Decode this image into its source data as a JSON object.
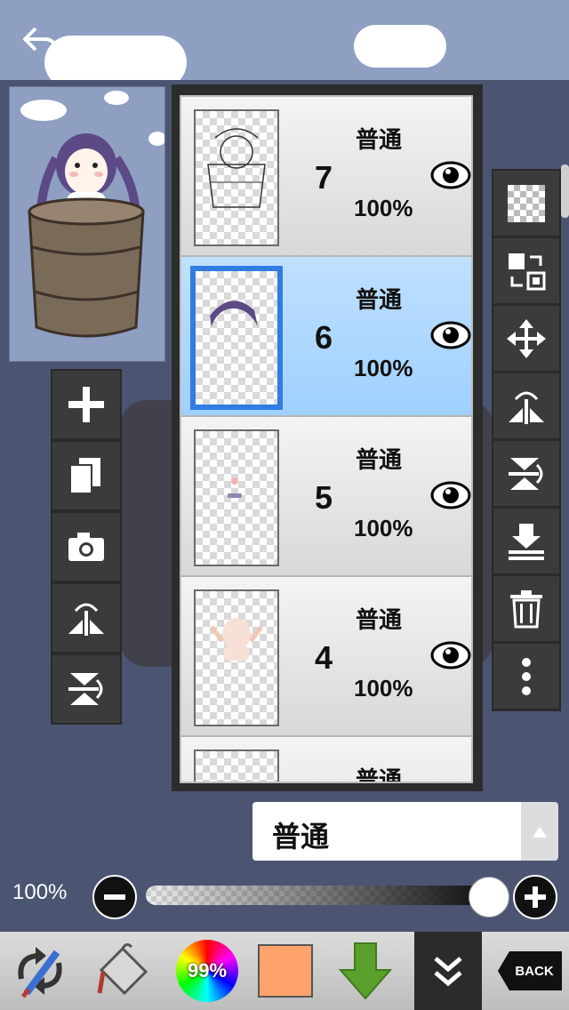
{
  "layers": [
    {
      "number": "7",
      "blend": "普通",
      "opacity": "100%",
      "visible": true,
      "selected": false
    },
    {
      "number": "6",
      "blend": "普通",
      "opacity": "100%",
      "visible": true,
      "selected": true
    },
    {
      "number": "5",
      "blend": "普通",
      "opacity": "100%",
      "visible": true,
      "selected": false
    },
    {
      "number": "4",
      "blend": "普通",
      "opacity": "100%",
      "visible": true,
      "selected": false
    },
    {
      "number": "",
      "blend": "普通",
      "opacity": "",
      "visible": true,
      "selected": false
    }
  ],
  "blend_mode": {
    "selected": "普通"
  },
  "opacity_control": {
    "label": "100%",
    "value": 1.0
  },
  "bottom_bar": {
    "color_wheel_label": "99%",
    "current_color": "#ffa26b",
    "back_label": "BACK"
  },
  "left_tools": [
    "add-layer-icon",
    "copy-layer-icon",
    "camera-icon",
    "flip-horizontal-icon",
    "flip-vertical-icon"
  ],
  "right_tools": [
    "transparent-icon",
    "swap-icon",
    "move-icon",
    "flip-horizontal-icon",
    "flip-vertical-icon",
    "merge-down-icon",
    "trash-icon",
    "more-icon"
  ],
  "colors": {
    "selected_layer": "#9fd0ff",
    "selected_border": "#2f7de1",
    "accent_green": "#5aa02c"
  }
}
